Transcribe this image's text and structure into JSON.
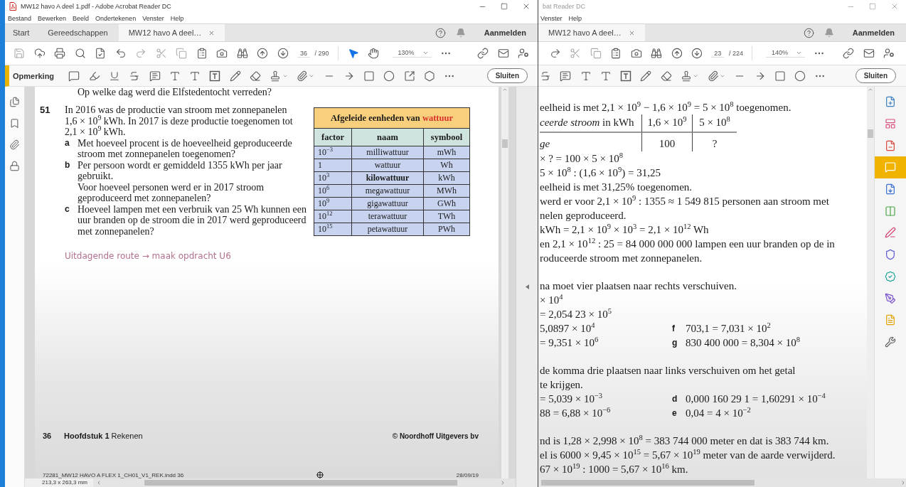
{
  "windows": [
    {
      "kind": "full",
      "title": "MW12 havo A deel 1.pdf - Adobe Acrobat Reader DC",
      "menu": [
        "Bestand",
        "Bewerken",
        "Beeld",
        "Ondertekenen",
        "Venster",
        "Help"
      ],
      "tabs": [
        {
          "label": "Start",
          "selected": false,
          "closable": false
        },
        {
          "label": "Gereedschappen",
          "selected": false,
          "closable": false
        },
        {
          "label": "MW12 havo A deel…",
          "selected": true,
          "closable": true
        }
      ],
      "sign_in": "Aanmelden",
      "page_number": "36",
      "page_total": "/ 290",
      "select_tool_active": true,
      "zoom": "130%",
      "comment_label": "Opmerking",
      "close_button": "Sluiten",
      "exercise_page": {
        "previous_question": "Op welke dag werd die Elfstedentocht verreden?",
        "number": "51",
        "intro": "In 2016 was de productie van stroom met zonnepanelen 1,6 × 10$^{9}$ kWh. In 2017 is deze productie toegenomen tot 2,1 × 10$^{9}$ kWh.",
        "questions": [
          {
            "letter": "a",
            "paragraphs": [
              "Met hoeveel procent is de hoeveelheid geproduceerde stroom met zonnepanelen toegenomen?"
            ]
          },
          {
            "letter": "b",
            "paragraphs": [
              "Per persoon wordt er gemiddeld 1355 kWh per jaar gebruikt.",
              "Voor hoeveel personen werd er in 2017 stroom geproduceerd met zonnepanelen?"
            ]
          },
          {
            "letter": "c",
            "paragraphs": [
              "Hoeveel lampen met een verbruik van 25 Wh kunnen een uur branden op de stroom die in 2017 werd geproduceerd met zonnepanelen?"
            ]
          }
        ],
        "link": "Uitdagende route → maak opdracht U6",
        "table": {
          "title": "Afgeleide eenheden van",
          "title_highlight": "wattuur",
          "columns": [
            "factor",
            "naam",
            "symbool"
          ],
          "rows": [
            [
              "10$^{−3}$",
              "milliwattuur",
              "mWh"
            ],
            [
              "1",
              "wattuur",
              "Wh"
            ],
            [
              "10$^{3}$",
              "**kilowattuur**",
              "kWh"
            ],
            [
              "10$^{6}$",
              "megawattuur",
              "MWh"
            ],
            [
              "10$^{9}$",
              "gigawattuur",
              "GWh"
            ],
            [
              "10$^{12}$",
              "terawattuur",
              "TWh"
            ],
            [
              "10$^{15}$",
              "petawattuur",
              "PWh"
            ]
          ]
        },
        "footer": {
          "page": "36",
          "chapter": "**Hoofdstuk 1** Rekenen",
          "publisher": "© Noordhoff Uitgevers bv"
        },
        "slug": [
          "72281_MW12 HAVO A FLEX 1_CH01_V1_REK.indd 36",
          "28/09/19"
        ]
      },
      "status": "213,3 x 263,3 mm"
    },
    {
      "kind": "partial",
      "title": "bat Reader DC",
      "menu": [
        "Venster",
        "Help"
      ],
      "tabs": [
        {
          "label": "MW12 havo A deel…",
          "selected": true,
          "closable": true
        }
      ],
      "sign_in": "Aanmelden",
      "page_number": "23",
      "page_total": "/ 224",
      "zoom": "140%",
      "close_button": "Sluiten",
      "tools": [
        {
          "selected": false
        },
        {
          "selected": false
        },
        {
          "selected": false
        },
        {
          "selected": true
        },
        {
          "selected": false
        },
        {
          "selected": false
        },
        {
          "selected": false
        },
        {
          "selected": false
        },
        {
          "selected": false
        },
        {
          "selected": false
        },
        {
          "selected": false
        },
        {
          "selected": false
        }
      ],
      "answer_page": {
        "blocks": [
          {
            "lines": [
              {
                "kind": "text",
                "text": "eelheid is met 2,1 × 10$^{9}$ − 1,6 × 10$^{9}$ = 5 × 10$^{8}$ toegenomen."
              },
              {
                "kind": "ratio_table",
                "rows": [
                  [
                    "*ceerde stroom* in kWh",
                    "1,6 × 10$^{9}$",
                    "5 × 10$^{8}$"
                  ],
                  [
                    "*ge*",
                    "100",
                    "?"
                  ]
                ]
              },
              {
                "kind": "text",
                "text": "× ? = 100 × 5 × 10$^{8}$"
              },
              {
                "kind": "text",
                "text": "5 × 10$^{8}$ : (1,6 × 10$^{9}$) = 31,25"
              },
              {
                "kind": "text",
                "text": "eelheid is met 31,25% toegenomen."
              },
              {
                "kind": "text",
                "text": "werd er voor 2,1 × 10$^{9}$ : 1355 ≈ 1 549 815 personen aan stroom met"
              },
              {
                "kind": "text",
                "text": "nelen geproduceerd."
              },
              {
                "kind": "text",
                "text": "kWh = 2,1 × 10$^{9}$ × 10$^{3}$ = 2,1 × 10$^{12}$ Wh"
              },
              {
                "kind": "text",
                "text": "en 2,1 × 10$^{12}$ : 25 = 84 000 000 000 lampen een uur branden op de in"
              },
              {
                "kind": "text",
                "text": "roduceerde stroom met zonnepanelen."
              }
            ]
          },
          {
            "lines": [
              {
                "kind": "text",
                "text": "na moet vier plaatsen naar rechts verschuiven."
              },
              {
                "kind": "text",
                "text": "× 10$^{4}$"
              },
              {
                "kind": "text",
                "text": "= 2,054 23 × 10$^{5}$"
              },
              {
                "kind": "pair",
                "left": "5,0897 × 10$^{4}$",
                "letter": "f",
                "right": "703,1 = 7,031 × 10$^{2}$"
              },
              {
                "kind": "pair",
                "left": "= 9,351 × 10$^{6}$",
                "letter": "g",
                "right": "830 400 000 = 8,304 × 10$^{8}$"
              }
            ]
          },
          {
            "lines": [
              {
                "kind": "text",
                "text": "de komma drie plaatsen naar links verschuiven om het getal"
              },
              {
                "kind": "text",
                "text": "te krijgen."
              },
              {
                "kind": "pair",
                "left": "= 5,039 × 10$^{−3}$",
                "letter": "d",
                "right": "0,000 160 29 1 = 1,60291 × 10$^{−4}$"
              },
              {
                "kind": "pair",
                "left": "88 = 6,88 × 10$^{−6}$",
                "letter": "e",
                "right": "0,04 = 4 × 10$^{−2}$"
              }
            ]
          },
          {
            "lines": [
              {
                "kind": "text",
                "text": "nd is 1,28 × 2,998 × 10$^{8}$ = 383 744 000 meter en dat is 383 744 km."
              },
              {
                "kind": "text",
                "text": "el is 6000 × 9,45 × 10$^{15}$ = 5,67 × 10$^{19}$ meter van de aarde verwijderd."
              },
              {
                "kind": "text",
                "text": "67 × 10$^{19}$ : 1000 = 5,67 × 10$^{16}$ km."
              }
            ]
          }
        ]
      }
    }
  ]
}
